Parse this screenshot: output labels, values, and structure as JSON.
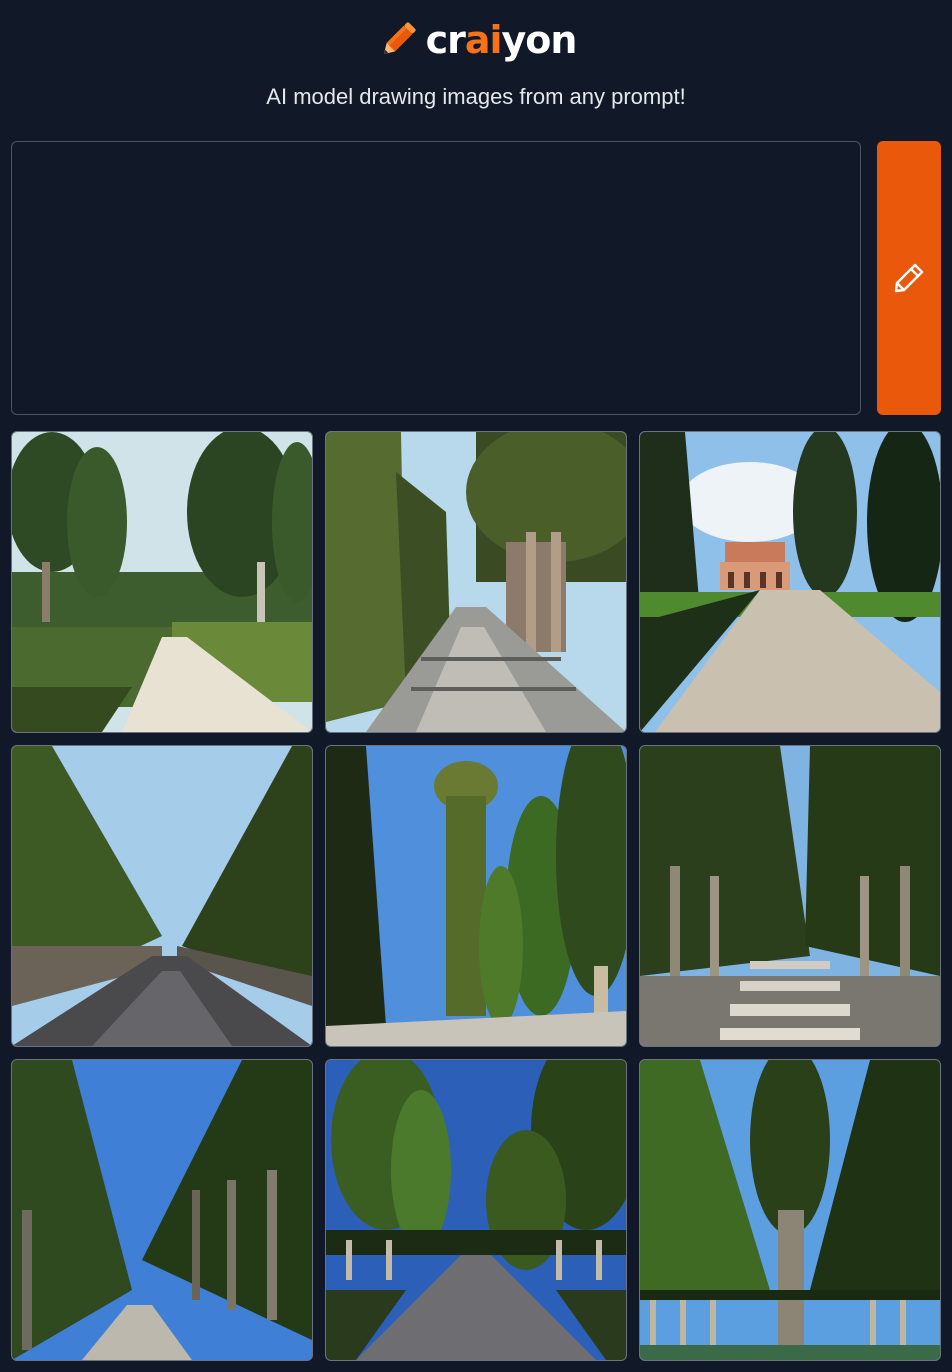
{
  "header": {
    "brand_prefix": "cr",
    "brand_accent": "ai",
    "brand_suffix": "yon",
    "tagline": "AI model drawing images from any prompt!"
  },
  "prompt": {
    "value": "",
    "placeholder": ""
  },
  "colors": {
    "background": "#111827",
    "accent": "#ea580c",
    "brand_orange": "#f97316"
  },
  "icons": {
    "logo": "pencil-icon",
    "draw_button": "pencil-icon"
  },
  "results": {
    "images": [
      {
        "id": 1,
        "scene": "cypress garden with hedges and columns"
      },
      {
        "id": 2,
        "scene": "ancient road lined with tall hedges"
      },
      {
        "id": 3,
        "scene": "cypress avenue leading to villa"
      },
      {
        "id": 4,
        "scene": "hedge-lined stone road"
      },
      {
        "id": 5,
        "scene": "tall cypress trees along road"
      },
      {
        "id": 6,
        "scene": "colonnade of trees with steps"
      },
      {
        "id": 7,
        "scene": "tree-lined avenue with columns"
      },
      {
        "id": 8,
        "scene": "cobbled road between cypress rows"
      },
      {
        "id": 9,
        "scene": "tree tunnel with colonnade"
      }
    ]
  }
}
